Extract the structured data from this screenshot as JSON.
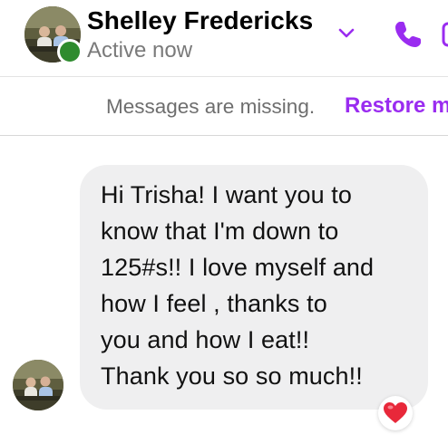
{
  "header": {
    "contact_name": "Shelley Fredericks",
    "status": "Active now",
    "avatar_icon": "profile-photo",
    "presence_color": "#2e8b2e",
    "chevron_icon": "chevron-down-icon",
    "phone_icon": "phone-icon",
    "video_icon": "video-camera-icon",
    "accent_color": "#9a2cf0"
  },
  "notice": {
    "text": "Messages are missing.",
    "action_label": "Restore m"
  },
  "message": {
    "lines": [
      "Hi Trisha! I want you to",
      "know that I'm down to",
      "125#s!! I love myself and",
      "how I feel , thanks to",
      "you and how I eat!!",
      "Thank you so so much!!"
    ],
    "bubble_color": "#efeff0",
    "reaction_icon": "red-heart-icon"
  }
}
